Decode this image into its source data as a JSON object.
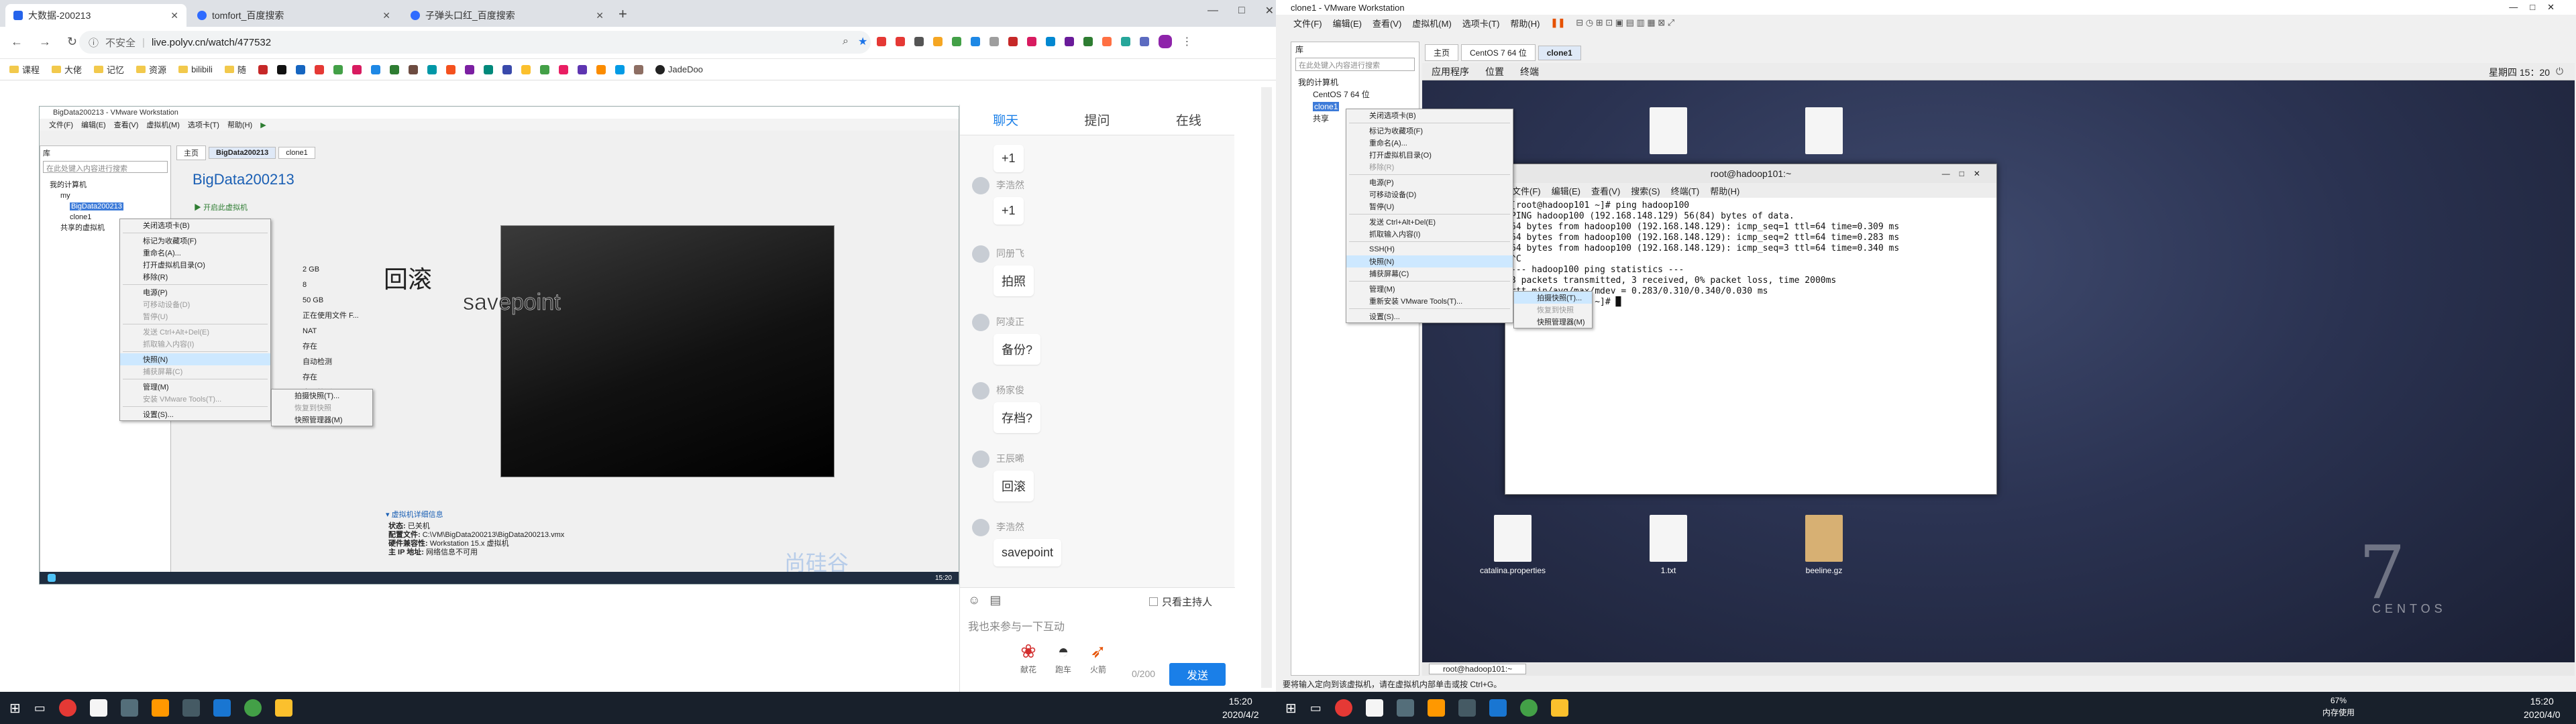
{
  "left_browser": {
    "tabs": [
      {
        "label": "大数据-200213",
        "active": true
      },
      {
        "label": "tomfort_百度搜索",
        "active": false
      },
      {
        "label": "子弹头口红_百度搜索",
        "active": false
      }
    ],
    "url": "live.polyv.cn/watch/477532",
    "security_label": "不安全",
    "bookmarks": [
      "课程",
      "大佬",
      "记忆",
      "资源",
      "bilibili",
      "随"
    ],
    "bookmark_right": "JadeDoo"
  },
  "inner_vmware": {
    "title": "BigData200213 - VMware Workstation",
    "menu": [
      "文件(F)",
      "编辑(E)",
      "查看(V)",
      "虚拟机(M)",
      "选项卡(T)",
      "帮助(H)"
    ],
    "library_label": "库",
    "search_placeholder": "在此处键入内容进行搜索",
    "tree": [
      "我的计算机",
      "my",
      "BigData200213",
      "clone1",
      "共享的虚拟机"
    ],
    "tabs": [
      "主页",
      "BigData200213",
      "clone1"
    ],
    "vm_name": "BigData200213",
    "power_on": "开启此虚拟机",
    "specs": [
      "2 GB",
      "8",
      "50 GB",
      "正在使用文件 F...",
      "NAT",
      "存在",
      "自动检测",
      "存在",
      "自动检测"
    ],
    "context_menu": [
      "关闭选项卡(B)",
      "标记为收藏项(F)",
      "重命名(A)...",
      "打开虚拟机目录(O)",
      "移除(R)",
      "电源(P)",
      "可移动设备(D)",
      "暂停(U)",
      "发送 Ctrl+Alt+Del(E)",
      "抓取输入内容(I)",
      "快照(N)",
      "捕获屏幕(C)",
      "管理(M)",
      "安装 VMware Tools(T)...",
      "设置(S)..."
    ],
    "snapshot_submenu": [
      "拍摄快照(T)...",
      "恢复到快照",
      "快照管理器(M)"
    ],
    "screen_text_1": "回滚",
    "screen_text_2": "savepoint",
    "details_title": "虚拟机详细信息",
    "details": [
      {
        "k": "状态:",
        "v": "已关机"
      },
      {
        "k": "配置文件:",
        "v": "C:\\VM\\BigData200213\\BigData200213.vmx"
      },
      {
        "k": "硬件兼容性:",
        "v": "Workstation 15.x 虚拟机"
      },
      {
        "k": "主 IP 地址:",
        "v": "网络信息不可用"
      }
    ],
    "taskbar_time": "15:20",
    "watermark": "尚硅谷"
  },
  "chat": {
    "tabs": [
      "聊天",
      "提问",
      "在线"
    ],
    "messages": [
      {
        "name": "",
        "text": "+1"
      },
      {
        "name": "李浩然",
        "text": "+1"
      },
      {
        "name": "同册飞",
        "text": "拍照"
      },
      {
        "name": "阿凌正",
        "text": "备份?"
      },
      {
        "name": "杨家俊",
        "text": "存档?"
      },
      {
        "name": "王辰晞",
        "text": "回滚"
      },
      {
        "name": "李浩然",
        "text": "savepoint"
      }
    ],
    "host_only": "只看主持人",
    "input_placeholder": "我也来参与一下互动",
    "counter": "0/200",
    "send": "发送",
    "gifts": [
      "献花",
      "跑车",
      "火箭"
    ]
  },
  "left_taskbar": {
    "time": "15:20",
    "date": "2020/4/2"
  },
  "right_vmware": {
    "title": "clone1 - VMware Workstation",
    "menu": [
      "文件(F)",
      "编辑(E)",
      "查看(V)",
      "虚拟机(M)",
      "选项卡(T)",
      "帮助(H)"
    ],
    "library_label": "库",
    "search_placeholder": "在此处键入内容进行搜索",
    "tree": [
      "我的计算机",
      "CentOS 7 64 位",
      "clone1",
      "共享"
    ],
    "tabs": [
      "主页",
      "CentOS 7 64 位",
      "clone1"
    ],
    "gnome_bar": [
      "应用程序",
      "位置",
      "终端"
    ],
    "gnome_clock": "星期四 15：20",
    "context_menu": [
      "关闭选项卡(B)",
      "标记为收藏项(F)",
      "重命名(A)...",
      "打开虚拟机目录(O)",
      "移除(R)",
      "电源(P)",
      "可移动设备(D)",
      "暂停(U)",
      "发送 Ctrl+Alt+Del(E)",
      "抓取输入内容(I)",
      "SSH(H)",
      "快照(N)",
      "捕获屏幕(C)",
      "管理(M)",
      "重新安装 VMware Tools(T)...",
      "设置(S)..."
    ],
    "snapshot_submenu": [
      "拍摄快照(T)...",
      "恢复到快照",
      "快照管理器(M)"
    ],
    "terminal_title": "root@hadoop101:~",
    "terminal_menu": [
      "文件(F)",
      "编辑(E)",
      "查看(V)",
      "搜索(S)",
      "终端(T)",
      "帮助(H)"
    ],
    "terminal_lines": [
      "[root@hadoop101 ~]# ping hadoop100",
      "PING hadoop100 (192.168.148.129) 56(84) bytes of data.",
      "64 bytes from hadoop100 (192.168.148.129): icmp_seq=1 ttl=64 time=0.309 ms",
      "64 bytes from hadoop100 (192.168.148.129): icmp_seq=2 ttl=64 time=0.283 ms",
      "64 bytes from hadoop100 (192.168.148.129): icmp_seq=3 ttl=64 time=0.340 ms",
      "^C",
      "--- hadoop100 ping statistics ---",
      "3 packets transmitted, 3 received, 0% packet loss, time 2000ms",
      "rtt min/avg/max/mdev = 0.283/0.310/0.340/0.030 ms",
      "[root@hadoop101 ~]# █"
    ],
    "desktop_icons": [
      "",
      "",
      "catalina.properties",
      "1.txt",
      "beeline.gz"
    ],
    "centos_big": "7",
    "centos_text": "CENTOS",
    "status_bar": "要将输入定向到该虚拟机，请在虚拟机内部单击或按 Ctrl+G。",
    "taskbar_window": "root@hadoop101:~"
  },
  "right_taskbar": {
    "time": "15:20",
    "date": "2020/4/0",
    "battery": "67%",
    "battery_sub": "内存使用"
  }
}
